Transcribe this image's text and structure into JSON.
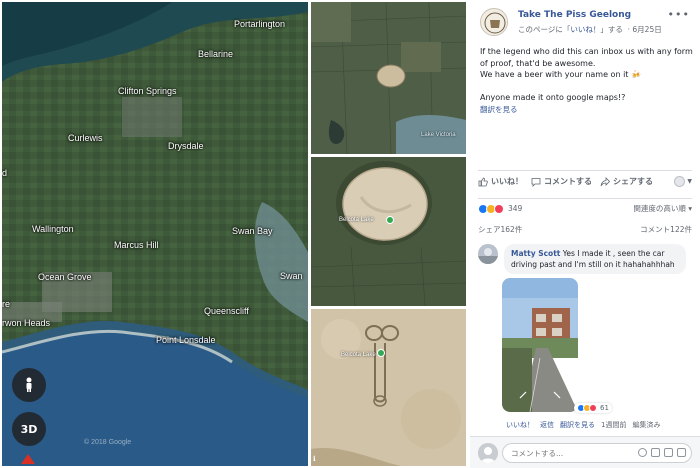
{
  "map": {
    "labels": {
      "portarlington": "Portarlington",
      "bellarine": "Bellarine",
      "clifton_springs": "Clifton Springs",
      "curlewis": "Curlewis",
      "drysdale": "Drysdale",
      "wallington": "Wallington",
      "marcus_hill": "Marcus Hill",
      "swan_bay": "Swan Bay",
      "ocean_grove": "Ocean Grove",
      "swan": "Swan",
      "queenscliff": "Queenscliff",
      "barwon_heads": "rwon Heads",
      "point_lonsdale": "Point Lonsdale",
      "re": "re",
      "d": "d"
    },
    "watermark": "© 2018 Google",
    "watermark2": "© 2018 Google",
    "btn_3d": "3D",
    "lake_victoria": "Lake Victoria",
    "lake_label_mid": "Belcota Lake",
    "lake_label_bottom": "Belcota Lake"
  },
  "post": {
    "page_name": "Take The Piss Geelong",
    "meta_prefix": "このページに「",
    "meta_like": "いいね！",
    "meta_suffix": "」する",
    "date": "6月25日",
    "more": "•••",
    "body_lines": [
      "If the legend who did this can inbox us with any form",
      "of proof, that'd be awesome.",
      "We have a beer with your name on it 🍻",
      "",
      "Anyone made it onto google maps!?"
    ],
    "translate": "翻訳を見る"
  },
  "actions": {
    "like": "いいね！",
    "comment": "コメントする",
    "share": "シェアする"
  },
  "reactions": {
    "count": "349",
    "sort": "関連度の高い順 ▾",
    "shares": "シェア162件",
    "comments": "コメント122件",
    "colors": {
      "like": "#1877f2",
      "haha": "#f7b125",
      "love": "#f33e58"
    }
  },
  "comment": {
    "author": "Matty Scott",
    "line1": " Yes I made it , seen the car",
    "line2": "driving past and I'm still on it hahahahhhah",
    "react_count": "61",
    "like": "いいね！",
    "reply": "返信",
    "translate": "翻訳を見る",
    "time": "1週間前",
    "edited": "編集済み",
    "sep": "·"
  },
  "write_comment": {
    "placeholder": "コメントする..."
  }
}
